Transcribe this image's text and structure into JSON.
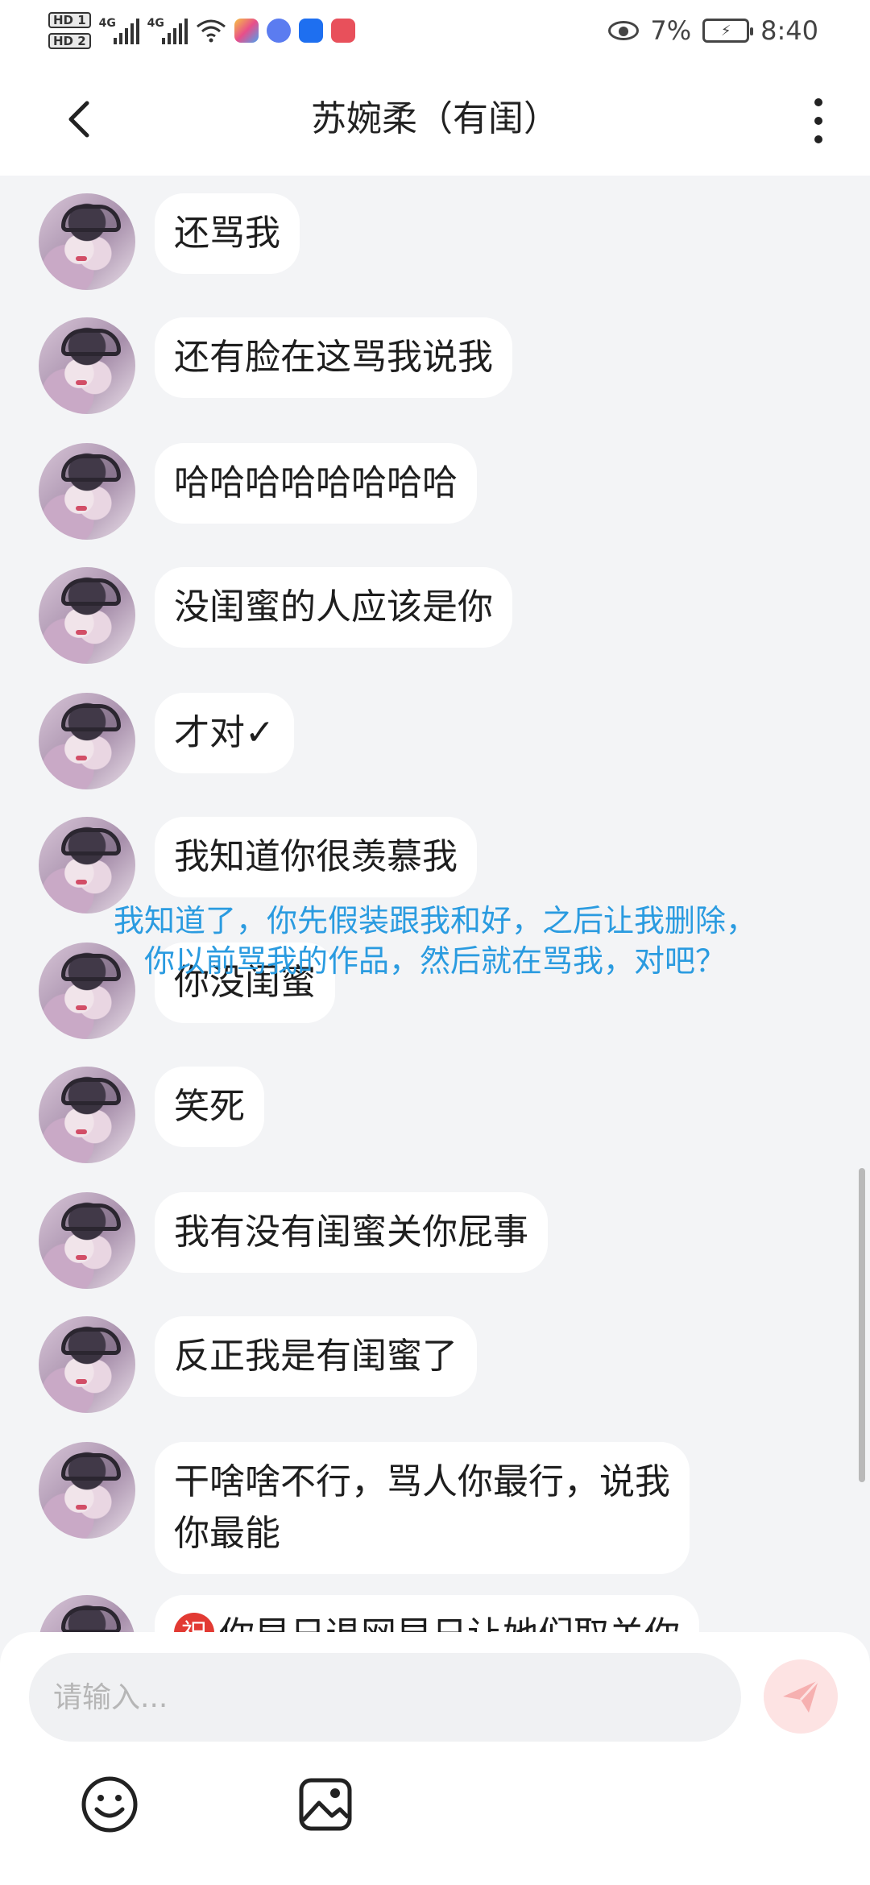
{
  "status_bar": {
    "hd1": "HD 1",
    "hd2": "HD 2",
    "net1": "4G",
    "net2": "4G",
    "battery_percent": "7%",
    "time": "8:40"
  },
  "header": {
    "title": "苏婉柔（有闺）"
  },
  "messages": [
    {
      "text": "还骂我"
    },
    {
      "text": "还有脸在这骂我说我"
    },
    {
      "text": "哈哈哈哈哈哈哈哈"
    },
    {
      "text": "没闺蜜的人应该是你"
    },
    {
      "text": "才对✓"
    },
    {
      "text": "我知道你很羡慕我"
    },
    {
      "text": "你没闺蜜"
    },
    {
      "text": "笑死"
    },
    {
      "text": "我有没有闺蜜关你屁事"
    },
    {
      "text": "反正我是有闺蜜了"
    },
    {
      "text": "干啥啥不行，骂人你最行，说我\n你最能"
    },
    {
      "badge": "祝",
      "text": "你早日退网早日让她们取关你"
    }
  ],
  "overlay_caption": {
    "line1": "我知道了，你先假装跟我和好，之后让我删除，",
    "line2": "你以前骂我的作品，然后就在骂我，对吧？"
  },
  "input": {
    "placeholder": "请输入...",
    "value": ""
  },
  "colors": {
    "background": "#f3f4f6",
    "overlay_text": "#2a9be0",
    "send_button": "#fde3e3",
    "send_icon": "#f6b0b0"
  },
  "icons": {
    "back": "chevron-left-icon",
    "more": "more-vertical-icon",
    "send": "paper-plane-icon",
    "emoji": "smiley-icon",
    "image": "image-icon"
  }
}
